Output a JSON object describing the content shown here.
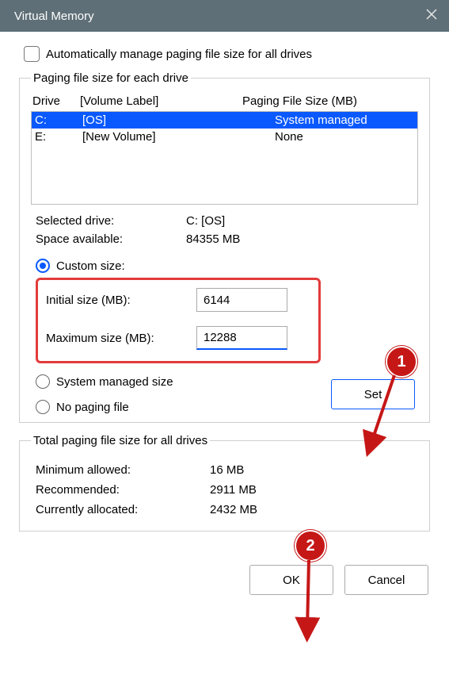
{
  "window_title": "Virtual Memory",
  "auto_label": "Automatically manage paging file size for all drives",
  "group1": {
    "legend": "Paging file size for each drive",
    "head_drive": "Drive",
    "head_volume": "[Volume Label]",
    "head_size": "Paging File Size (MB)",
    "rows": [
      {
        "drive": "C:",
        "volume": "[OS]",
        "size": "System managed",
        "selected": true
      },
      {
        "drive": "E:",
        "volume": "[New Volume]",
        "size": "None",
        "selected": false
      }
    ],
    "selected_drive_lbl": "Selected drive:",
    "selected_drive_val": "C:  [OS]",
    "space_lbl": "Space available:",
    "space_val": "84355 MB",
    "radio_custom": "Custom size:",
    "initial_lbl": "Initial size (MB):",
    "initial_val": "6144",
    "max_lbl": "Maximum size (MB):",
    "max_val": "12288",
    "radio_sys": "System managed size",
    "radio_none": "No paging file",
    "set_btn": "Set"
  },
  "group2": {
    "legend": "Total paging file size for all drives",
    "min_lbl": "Minimum allowed:",
    "min_val": "16 MB",
    "rec_lbl": "Recommended:",
    "rec_val": "2911 MB",
    "cur_lbl": "Currently allocated:",
    "cur_val": "2432 MB"
  },
  "ok_btn": "OK",
  "cancel_btn": "Cancel",
  "anno": {
    "badge1": "1",
    "badge2": "2"
  }
}
